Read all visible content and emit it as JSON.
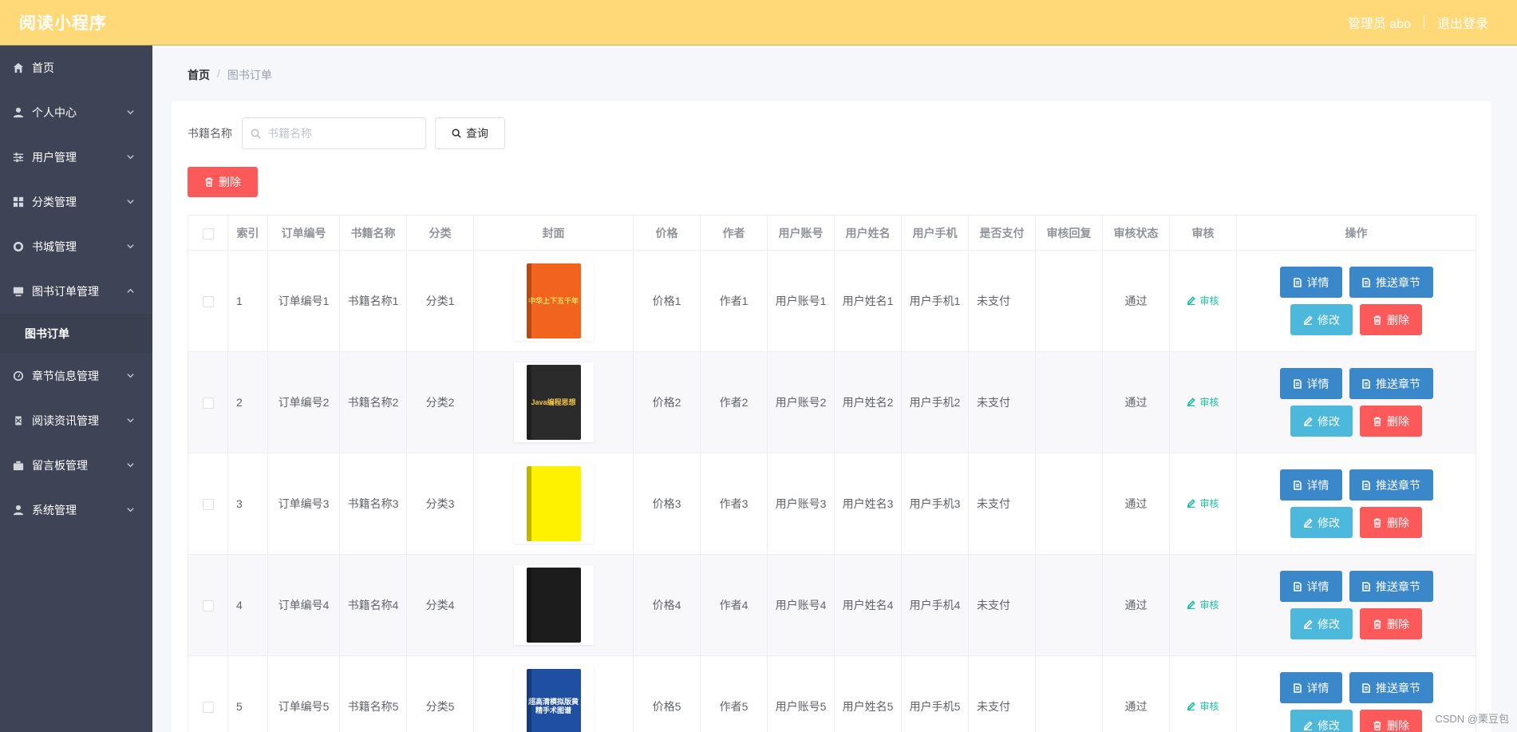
{
  "app": {
    "title": "阅读小程序"
  },
  "header": {
    "user_label": "管理员 abo",
    "logout_label": "退出登录"
  },
  "sidebar": {
    "items": [
      {
        "label": "首页",
        "icon": "home-icon"
      },
      {
        "label": "个人中心",
        "icon": "user-icon"
      },
      {
        "label": "用户管理",
        "icon": "sliders-icon"
      },
      {
        "label": "分类管理",
        "icon": "grid-icon"
      },
      {
        "label": "书城管理",
        "icon": "ring-icon"
      },
      {
        "label": "图书订单管理",
        "icon": "monitor-icon"
      },
      {
        "label": "章节信息管理",
        "icon": "gauge-icon"
      },
      {
        "label": "阅读资讯管理",
        "icon": "doc-icon"
      },
      {
        "label": "留言板管理",
        "icon": "case-icon"
      },
      {
        "label": "系统管理",
        "icon": "user-icon"
      }
    ],
    "active_sub": "图书订单"
  },
  "breadcrumb": {
    "home": "首页",
    "separator": "/",
    "current": "图书订单"
  },
  "search": {
    "label": "书籍名称",
    "placeholder": "书籍名称",
    "query_label": "查询"
  },
  "toolbar": {
    "delete_label": "删除"
  },
  "table": {
    "headers": [
      "索引",
      "订单编号",
      "书籍名称",
      "分类",
      "封面",
      "价格",
      "作者",
      "用户账号",
      "用户姓名",
      "用户手机",
      "是否支付",
      "审核回复",
      "审核状态",
      "审核",
      "操作"
    ],
    "action_labels": {
      "audit": "审核",
      "detail": "详情",
      "push": "推送章节",
      "edit": "修改",
      "delete": "删除"
    },
    "rows": [
      {
        "index": "1",
        "order_no": "订单编号1",
        "book_name": "书籍名称1",
        "category": "分类1",
        "price": "价格1",
        "author": "作者1",
        "account": "用户账号1",
        "user_name": "用户姓名1",
        "phone": "用户手机1",
        "paid": "未支付",
        "reply": "",
        "status": "通过",
        "cover_color": "#f0641e",
        "cover_text": "中华上下五千年",
        "cover_text_color": "#ffe066"
      },
      {
        "index": "2",
        "order_no": "订单编号2",
        "book_name": "书籍名称2",
        "category": "分类2",
        "price": "价格2",
        "author": "作者2",
        "account": "用户账号2",
        "user_name": "用户姓名2",
        "phone": "用户手机2",
        "paid": "未支付",
        "reply": "",
        "status": "通过",
        "cover_color": "#2b2b2b",
        "cover_text": "Java编程思想",
        "cover_text_color": "#f3c545"
      },
      {
        "index": "3",
        "order_no": "订单编号3",
        "book_name": "书籍名称3",
        "category": "分类3",
        "price": "价格3",
        "author": "作者3",
        "account": "用户账号3",
        "user_name": "用户姓名3",
        "phone": "用户手机3",
        "paid": "未支付",
        "reply": "",
        "status": "通过",
        "cover_color": "#fff200",
        "cover_text": "",
        "cover_text_color": "#333333"
      },
      {
        "index": "4",
        "order_no": "订单编号4",
        "book_name": "书籍名称4",
        "category": "分类4",
        "price": "价格4",
        "author": "作者4",
        "account": "用户账号4",
        "user_name": "用户姓名4",
        "phone": "用户手机4",
        "paid": "未支付",
        "reply": "",
        "status": "通过",
        "cover_color": "#1c1c1c",
        "cover_text": "",
        "cover_text_color": "#e5b84a"
      },
      {
        "index": "5",
        "order_no": "订单编号5",
        "book_name": "书籍名称5",
        "category": "分类5",
        "price": "价格5",
        "author": "作者5",
        "account": "用户账号5",
        "user_name": "用户姓名5",
        "phone": "用户手机5",
        "paid": "未支付",
        "reply": "",
        "status": "通过",
        "cover_color": "#1e4fa0",
        "cover_text": "超高清模拟版黄精手术图谱",
        "cover_text_color": "#ffffff"
      }
    ]
  },
  "watermark": "CSDN @栗豆包",
  "colors": {
    "header_bg": "#ffd877",
    "sidebar_bg": "#3e4455",
    "primary": "#3a87c9",
    "info": "#4cb9dc",
    "danger": "#fc5a5a",
    "success_text": "#1bc2a0"
  }
}
